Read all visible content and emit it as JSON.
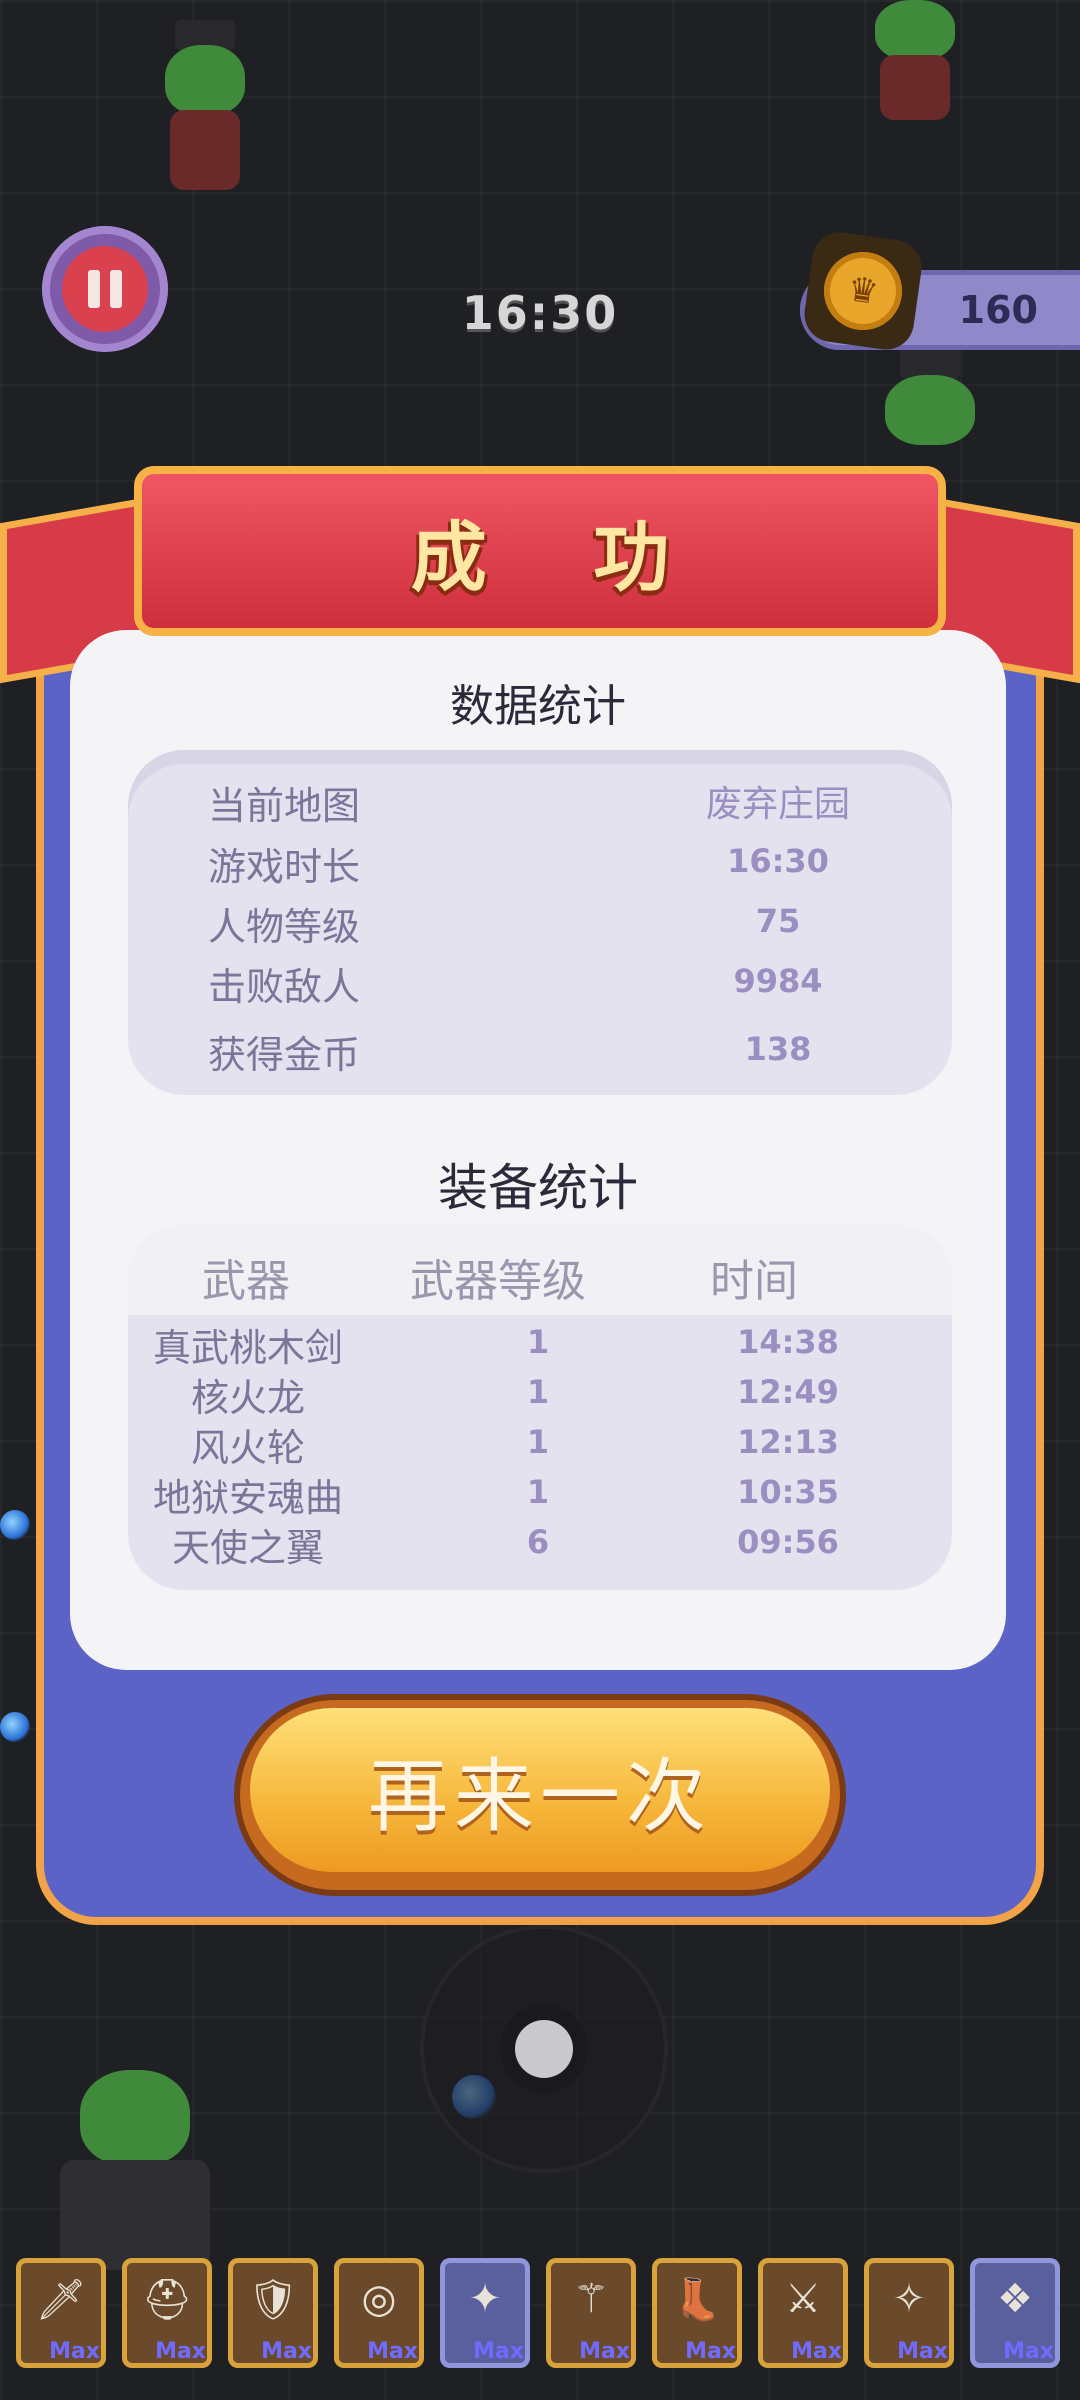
{
  "hud": {
    "time": "16:30",
    "coins": "160"
  },
  "dialog": {
    "title": "成 功",
    "stats_title": "数据统计",
    "stats": [
      {
        "label": "当前地图",
        "value": "废弃庄园"
      },
      {
        "label": "游戏时长",
        "value": "16:30"
      },
      {
        "label": "人物等级",
        "value": "75"
      },
      {
        "label": "击败敌人",
        "value": "9984"
      },
      {
        "label": "获得金币",
        "value": "138"
      }
    ],
    "equip_title": "装备统计",
    "equip_headers": [
      "武器",
      "武器等级",
      "时间"
    ],
    "equipment": [
      {
        "name": "真武桃木剑",
        "level": "1",
        "time": "14:38"
      },
      {
        "name": "核火龙",
        "level": "1",
        "time": "12:49"
      },
      {
        "name": "风火轮",
        "level": "1",
        "time": "12:13"
      },
      {
        "name": "地狱安魂曲",
        "level": "1",
        "time": "10:35"
      },
      {
        "name": "天使之翼",
        "level": "6",
        "time": "09:56"
      }
    ],
    "again_label": "再来一次"
  },
  "slots": [
    {
      "icon": "sword-icon",
      "glyph": "🗡",
      "badge": "Max"
    },
    {
      "icon": "helmet-icon",
      "glyph": "⛑",
      "badge": "Max"
    },
    {
      "icon": "shield-icon",
      "glyph": "🛡",
      "badge": "Max"
    },
    {
      "icon": "ring-icon",
      "glyph": "◎",
      "badge": "Max"
    },
    {
      "icon": "wings-icon",
      "glyph": "✦",
      "badge": "Max"
    },
    {
      "icon": "staff-icon",
      "glyph": "⚚",
      "badge": "Max"
    },
    {
      "icon": "boots-icon",
      "glyph": "👢",
      "badge": "Max"
    },
    {
      "icon": "blade-icon",
      "glyph": "⚔",
      "badge": "Max"
    },
    {
      "icon": "fish-icon",
      "glyph": "✧",
      "badge": "Max"
    },
    {
      "icon": "demon-wings-icon",
      "glyph": "❖",
      "badge": "Max"
    }
  ]
}
